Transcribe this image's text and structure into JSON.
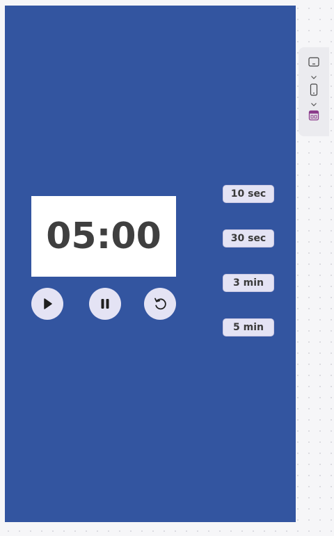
{
  "timer": {
    "display": "05:00"
  },
  "controls": [
    {
      "name": "play-button",
      "icon": "play-icon"
    },
    {
      "name": "pause-button",
      "icon": "pause-icon"
    },
    {
      "name": "reset-button",
      "icon": "reset-icon"
    }
  ],
  "presets": [
    {
      "label": "10 sec"
    },
    {
      "label": "30 sec"
    },
    {
      "label": "3 min"
    },
    {
      "label": "5 min"
    }
  ],
  "toolbar": {
    "items": [
      {
        "icon": "desktop-frame-icon"
      },
      {
        "icon": "chevron-down-icon"
      },
      {
        "icon": "mobile-frame-icon"
      },
      {
        "icon": "chevron-down-icon"
      },
      {
        "icon": "app-window-icon"
      }
    ]
  },
  "colors": {
    "frame_background": "#3355a0",
    "button_background": "#e4e3f4",
    "timer_text": "#3f3f3f",
    "accent": "#8a3a8a"
  }
}
